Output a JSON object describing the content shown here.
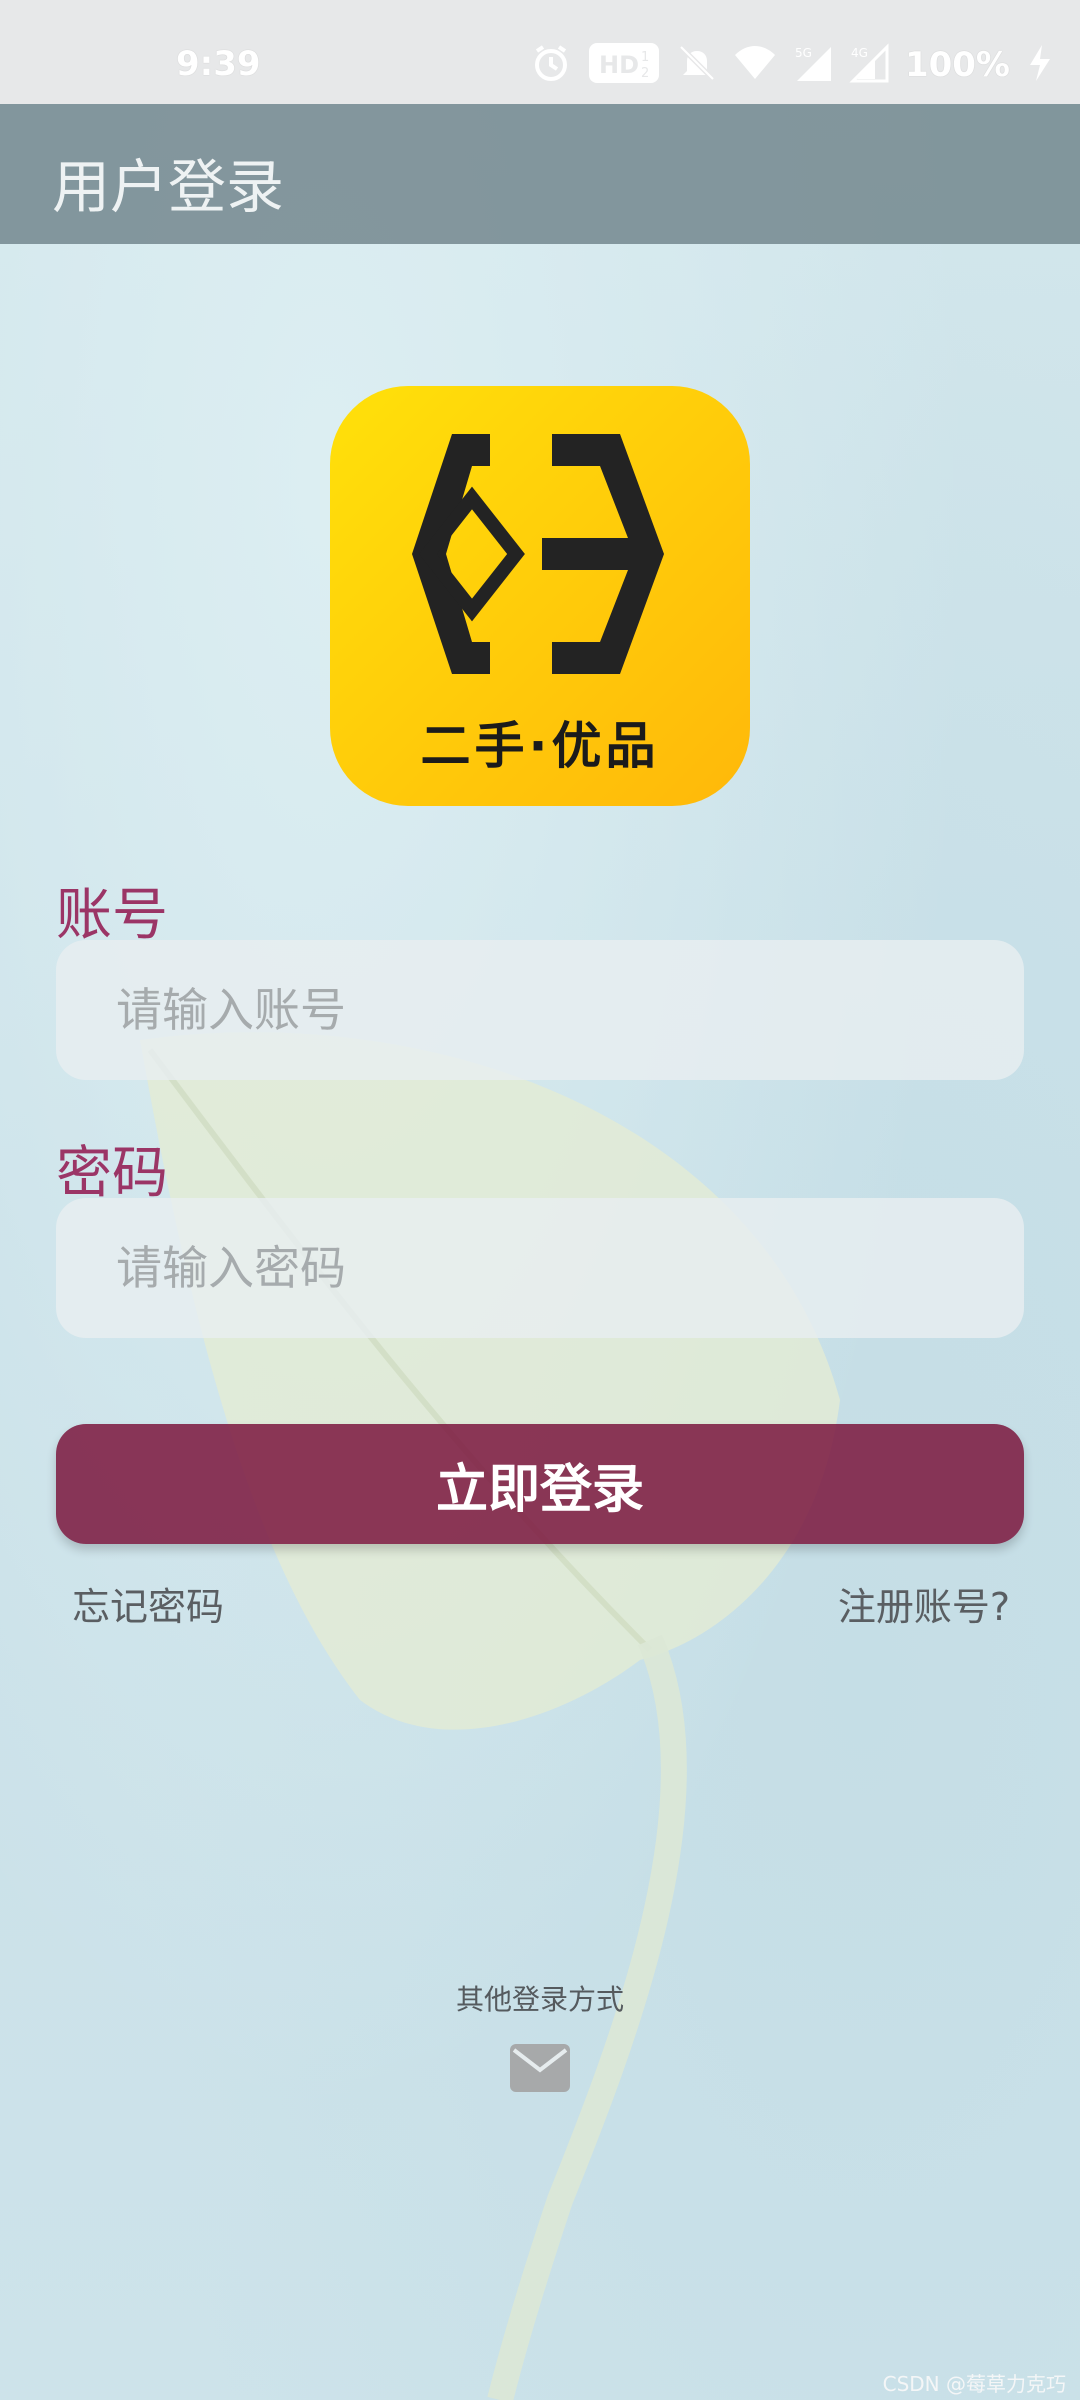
{
  "status_bar": {
    "time": "9:39",
    "battery": "100%",
    "icons": [
      "alarm-icon",
      "hd-icon",
      "mute-icon",
      "wifi-icon",
      "5g-signal-icon",
      "4g-signal-icon",
      "battery-charging-icon"
    ]
  },
  "app_bar": {
    "title": "用户登录"
  },
  "logo": {
    "text": "二手·优品",
    "icon": "app-logo-icon"
  },
  "form": {
    "account_label": "账号",
    "account_placeholder": "请输入账号",
    "password_label": "密码",
    "password_placeholder": "请输入密码",
    "login_button": "立即登录",
    "forgot_password": "忘记密码",
    "register": "注册账号?"
  },
  "other_login": {
    "title": "其他登录方式",
    "icon": "mail-icon"
  },
  "watermark": "CSDN @莓草力克巧",
  "colors": {
    "accent": "#9b3566",
    "button": "#7d1c42",
    "app_bar": "#73878e",
    "logo_yellow": "#ffd20a"
  }
}
